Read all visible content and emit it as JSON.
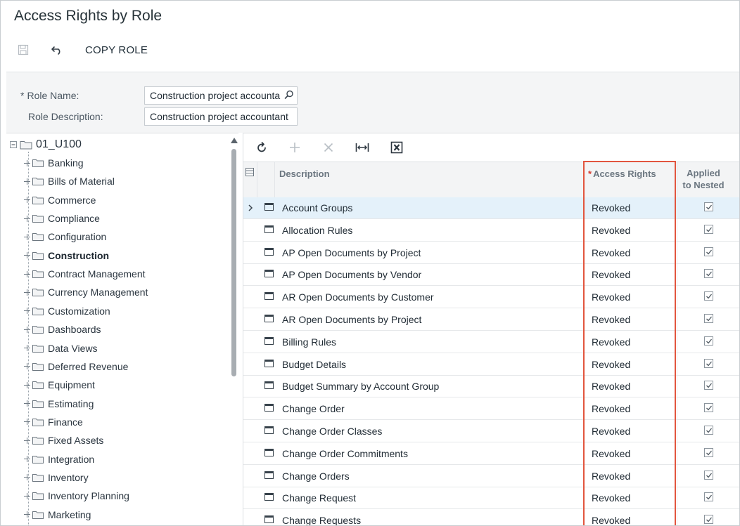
{
  "page": {
    "title": "Access Rights by Role"
  },
  "toolbar": {
    "save_icon": "save-icon",
    "undo_icon": "undo-icon",
    "copy_role_label": "COPY ROLE"
  },
  "form": {
    "role_name_label": "Role Name:",
    "role_name_required": "*",
    "role_name_value": "Construction project accounta",
    "role_description_label": "Role Description:",
    "role_description_value": "Construction project accountant"
  },
  "tree": {
    "root": "01_U100",
    "items": [
      {
        "label": "Banking",
        "bold": false
      },
      {
        "label": "Bills of Material",
        "bold": false
      },
      {
        "label": "Commerce",
        "bold": false
      },
      {
        "label": "Compliance",
        "bold": false
      },
      {
        "label": "Configuration",
        "bold": false
      },
      {
        "label": "Construction",
        "bold": true
      },
      {
        "label": "Contract Management",
        "bold": false
      },
      {
        "label": "Currency Management",
        "bold": false
      },
      {
        "label": "Customization",
        "bold": false
      },
      {
        "label": "Dashboards",
        "bold": false
      },
      {
        "label": "Data Views",
        "bold": false
      },
      {
        "label": "Deferred Revenue",
        "bold": false
      },
      {
        "label": "Equipment",
        "bold": false
      },
      {
        "label": "Estimating",
        "bold": false
      },
      {
        "label": "Finance",
        "bold": false
      },
      {
        "label": "Fixed Assets",
        "bold": false
      },
      {
        "label": "Integration",
        "bold": false
      },
      {
        "label": "Inventory",
        "bold": false
      },
      {
        "label": "Inventory Planning",
        "bold": false
      },
      {
        "label": "Marketing",
        "bold": false
      }
    ]
  },
  "grid": {
    "toolbar_icons": [
      "refresh-icon",
      "add-icon",
      "delete-icon",
      "fit-columns-icon",
      "export-excel-icon"
    ],
    "columns": {
      "description": "Description",
      "access_rights": "Access Rights",
      "access_rights_required": "*",
      "applied_line1": "Applied",
      "applied_line2": "to Nested"
    },
    "rows": [
      {
        "description": "Account Groups",
        "access_rights": "Revoked",
        "applied": true,
        "selected": true
      },
      {
        "description": "Allocation Rules",
        "access_rights": "Revoked",
        "applied": true
      },
      {
        "description": "AP Open Documents by Project",
        "access_rights": "Revoked",
        "applied": true
      },
      {
        "description": "AP Open Documents by Vendor",
        "access_rights": "Revoked",
        "applied": true
      },
      {
        "description": "AR Open Documents by Customer",
        "access_rights": "Revoked",
        "applied": true
      },
      {
        "description": "AR Open Documents by Project",
        "access_rights": "Revoked",
        "applied": true
      },
      {
        "description": "Billing Rules",
        "access_rights": "Revoked",
        "applied": true
      },
      {
        "description": "Budget Details",
        "access_rights": "Revoked",
        "applied": true
      },
      {
        "description": "Budget Summary by Account Group",
        "access_rights": "Revoked",
        "applied": true
      },
      {
        "description": "Change Order",
        "access_rights": "Revoked",
        "applied": true
      },
      {
        "description": "Change Order Classes",
        "access_rights": "Revoked",
        "applied": true
      },
      {
        "description": "Change Order Commitments",
        "access_rights": "Revoked",
        "applied": true
      },
      {
        "description": "Change Orders",
        "access_rights": "Revoked",
        "applied": true
      },
      {
        "description": "Change Request",
        "access_rights": "Revoked",
        "applied": true
      },
      {
        "description": "Change Requests",
        "access_rights": "Revoked",
        "applied": true
      }
    ]
  },
  "colors": {
    "highlight": "#e2553e",
    "selected_row": "#e4f1fa",
    "required": "#d3392d"
  }
}
